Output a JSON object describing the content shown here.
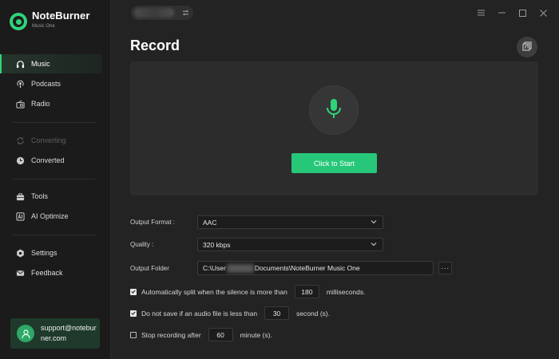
{
  "app": {
    "name": "NoteBurner",
    "subtitle": "Music One"
  },
  "colors": {
    "accent": "#2fd47a",
    "button": "#26c779",
    "background": "#232323",
    "sidebar": "#1b1b1b"
  },
  "sidebar": {
    "items": [
      {
        "label": "Music",
        "icon": "headphones-icon",
        "active": true
      },
      {
        "label": "Podcasts",
        "icon": "podcast-icon"
      },
      {
        "label": "Radio",
        "icon": "radio-icon"
      },
      {
        "label": "Converting",
        "icon": "converting-icon",
        "disabled": true
      },
      {
        "label": "Converted",
        "icon": "clock-icon"
      },
      {
        "label": "Tools",
        "icon": "toolbox-icon"
      },
      {
        "label": "AI Optimize",
        "icon": "ai-icon"
      },
      {
        "label": "Settings",
        "icon": "gear-icon"
      },
      {
        "label": "Feedback",
        "icon": "mail-icon"
      }
    ],
    "support_email": "support@noteburner.com"
  },
  "topbar": {
    "switch_icon": "switch-arrows-icon",
    "window_controls": [
      "menu-icon",
      "minimize-icon",
      "maximize-icon",
      "close-icon"
    ]
  },
  "page": {
    "title": "Record",
    "action_icon": "record-list-icon"
  },
  "record": {
    "mic_icon": "microphone-icon",
    "start_label": "Click to Start"
  },
  "settings": {
    "output_format": {
      "label": "Output Format :",
      "value": "AAC"
    },
    "quality": {
      "label": "Quality :",
      "value": "320 kbps"
    },
    "output_folder": {
      "label": "Output Folder",
      "prefix": "C:\\User",
      "suffix": "Documents\\NoteBurner Music One",
      "more_label": "···"
    }
  },
  "options": {
    "auto_split": {
      "checked": true,
      "text_before": "Automatically split when the silence is more than",
      "value": "180",
      "text_after": "milliseconds."
    },
    "min_length": {
      "checked": true,
      "text_before": "Do not save if an audio file is less than",
      "value": "30",
      "text_after": "second (s)."
    },
    "stop_after": {
      "checked": false,
      "text_before": "Stop recording after",
      "value": "60",
      "text_after": "minute (s)."
    }
  }
}
